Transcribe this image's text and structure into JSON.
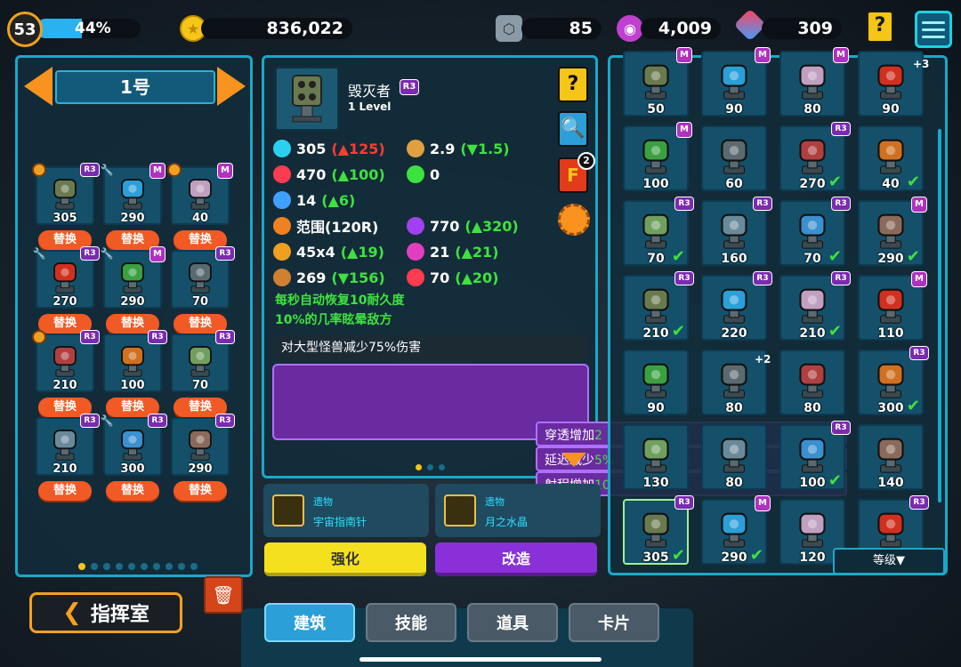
{
  "player": {
    "level": "53",
    "xp_text": "44%",
    "xp_fraction": 0.44
  },
  "resources": {
    "coins": "836,022",
    "hex": "85",
    "purple": "4,009",
    "gems": "309"
  },
  "left_panel": {
    "page_title": "1号",
    "replace_label": "替换",
    "slots": [
      "305",
      "290",
      "40",
      "270",
      "290",
      "70",
      "210",
      "100",
      "70",
      "210",
      "300",
      "290"
    ],
    "page_count": 10,
    "active_page": 0
  },
  "detail": {
    "name": "毁灭者",
    "rank": "R3",
    "level": "1 Level",
    "stats": [
      {
        "icon": "power-icon",
        "base": "305",
        "delta": "(▲125)",
        "delta_color": "#ff3b30"
      },
      {
        "icon": "timer-icon",
        "base": "2.9",
        "delta": "(▼1.5)",
        "delta_color": "#3ee23e"
      },
      {
        "icon": "heart-icon",
        "base": "470",
        "delta": "(▲100)",
        "delta_color": "#3ee23e"
      },
      {
        "icon": "shield-lock-icon",
        "base": "0",
        "delta": "",
        "delta_color": "#3ee23e"
      },
      {
        "icon": "armor-icon",
        "base": "14",
        "delta": "(▲6)",
        "delta_color": "#3ee23e"
      },
      {
        "icon": "range-icon",
        "base": "范围(120R)",
        "delta": "",
        "delta_color": "#3ee23e"
      },
      {
        "icon": "fire-icon",
        "base": "770",
        "delta": "(▲320)",
        "delta_color": "#3ee23e"
      },
      {
        "icon": "burst-icon",
        "base": "45x4",
        "delta": "(▲19)",
        "delta_color": "#3ee23e"
      },
      {
        "icon": "split-icon",
        "base": "21",
        "delta": "(▲21)",
        "delta_color": "#3ee23e"
      },
      {
        "icon": "gear-stat-icon",
        "base": "269",
        "delta": "(▼156)",
        "delta_color": "#3ee23e"
      },
      {
        "icon": "magnet-icon",
        "base": "70",
        "delta": "(▲20)",
        "delta_color": "#3ee23e"
      }
    ],
    "desc_1": "每秒自动恢复10耐久度",
    "desc_2": "10%的几率眩晕敌方",
    "effect_main": "对大型怪兽减少75%伤害",
    "effects": [
      {
        "prefix": "穿透增加",
        "value": "2"
      },
      {
        "prefix": "延迟减少",
        "value": "5%"
      },
      {
        "prefix": "射程增加",
        "value": "10"
      }
    ],
    "card_badge": "2"
  },
  "relics": [
    {
      "category": "遗物",
      "name": "宇宙指南针"
    },
    {
      "category": "遗物",
      "name": "月之水晶"
    }
  ],
  "buttons": {
    "upgrade": "强化",
    "modify": "改造"
  },
  "right_grid": {
    "slots": [
      "50",
      "90",
      "80",
      "90",
      "100",
      "60",
      "270",
      "40",
      "70",
      "160",
      "70",
      "290",
      "210",
      "220",
      "210",
      "110",
      "90",
      "80",
      "80",
      "300",
      "130",
      "80",
      "100",
      "140",
      "305",
      "290",
      "120",
      ""
    ],
    "plus_3": "+3",
    "plus_2": "+2",
    "sort_label": "等级▼"
  },
  "bottom": {
    "back_label": "指挥室",
    "tabs": [
      "建筑",
      "技能",
      "道具",
      "卡片"
    ]
  },
  "colors": {
    "accent": "#1aa8c8",
    "orange": "#f15a24",
    "yellow": "#f5e020",
    "purple": "#8a30d8",
    "green": "#3ee23e"
  }
}
